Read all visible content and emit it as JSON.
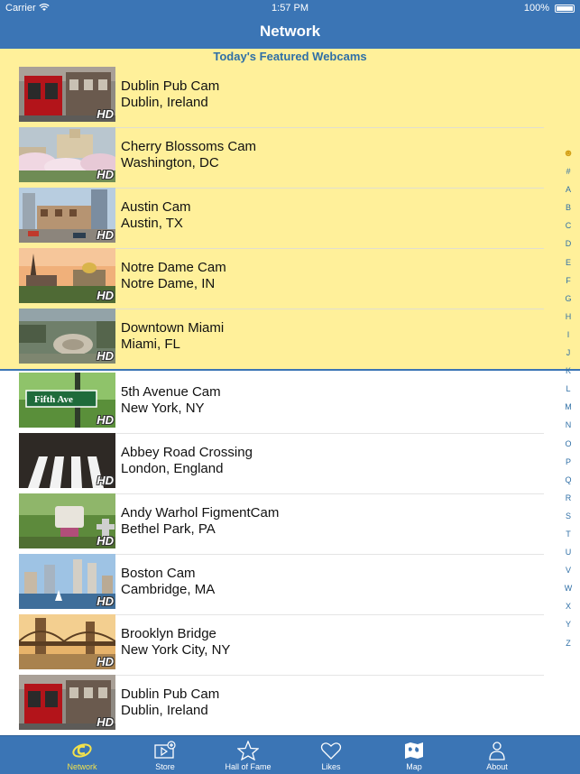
{
  "status": {
    "carrier": "Carrier",
    "time": "1:57 PM",
    "battery": "100%"
  },
  "nav": {
    "title": "Network"
  },
  "featured": {
    "header": "Today's Featured Webcams",
    "items": [
      {
        "name": "Dublin Pub Cam",
        "place": "Dublin, Ireland",
        "badge": "HD"
      },
      {
        "name": "Cherry Blossoms Cam",
        "place": "Washington, DC",
        "badge": "HD"
      },
      {
        "name": "Austin Cam",
        "place": "Austin, TX",
        "badge": "HD"
      },
      {
        "name": "Notre Dame Cam",
        "place": "Notre Dame, IN",
        "badge": "HD"
      },
      {
        "name": "Downtown Miami",
        "place": "Miami, FL",
        "badge": "HD"
      }
    ]
  },
  "list": {
    "items": [
      {
        "name": "5th Avenue Cam",
        "place": "New York, NY",
        "badge": "HD",
        "sign_text": "Fifth Ave"
      },
      {
        "name": "Abbey Road Crossing",
        "place": "London, England",
        "badge": "HD"
      },
      {
        "name": "Andy Warhol FigmentCam",
        "place": "Bethel Park, PA",
        "badge": "HD"
      },
      {
        "name": "Boston Cam",
        "place": "Cambridge, MA",
        "badge": "HD"
      },
      {
        "name": "Brooklyn Bridge",
        "place": "New York City, NY",
        "badge": "HD"
      },
      {
        "name": "Dublin Pub Cam",
        "place": "Dublin, Ireland",
        "badge": "HD"
      }
    ]
  },
  "index_letters": [
    "☻",
    "#",
    "A",
    "B",
    "C",
    "D",
    "E",
    "F",
    "G",
    "H",
    "I",
    "J",
    "K",
    "L",
    "M",
    "N",
    "O",
    "P",
    "Q",
    "R",
    "S",
    "T",
    "U",
    "V",
    "W",
    "X",
    "Y",
    "Z"
  ],
  "tabs": [
    {
      "label": "Network",
      "icon": "network-icon",
      "active": true
    },
    {
      "label": "Store",
      "icon": "store-icon"
    },
    {
      "label": "Hall of Fame",
      "icon": "star-icon"
    },
    {
      "label": "Likes",
      "icon": "heart-icon"
    },
    {
      "label": "Map",
      "icon": "map-icon"
    },
    {
      "label": "About",
      "icon": "person-icon"
    }
  ],
  "colors": {
    "bar": "#3b75b5",
    "featured_bg": "#fff09a",
    "accent": "#f3e24c"
  }
}
